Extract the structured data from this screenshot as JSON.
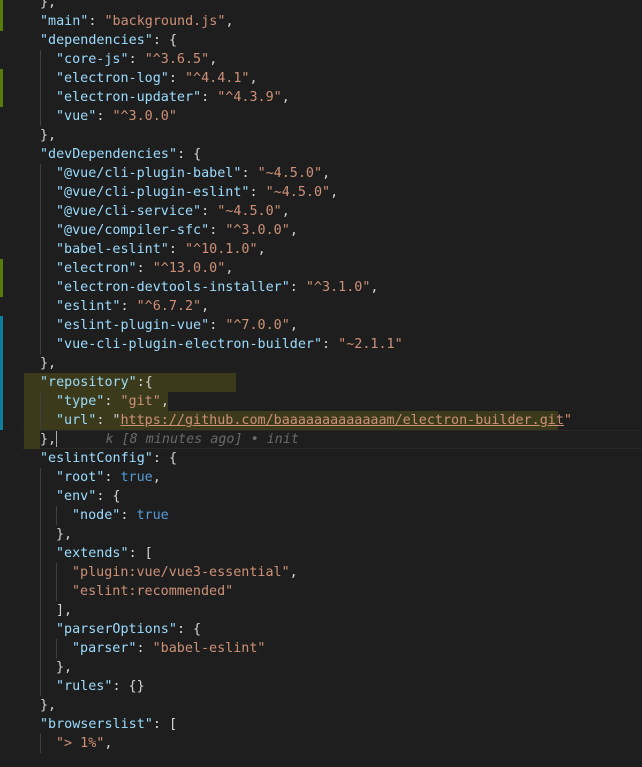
{
  "editor": {
    "language": "json",
    "blame_annotation": "k [8 minutes ago] • init",
    "lines": [
      {
        "kind": "partial",
        "gutter": "modified",
        "indent": 0,
        "text": "}",
        "tokens": [
          {
            "c": "t-punc",
            "v": "},"
          }
        ]
      },
      {
        "gutter": "modified",
        "indent": 0,
        "tokens": [
          {
            "c": "t-key",
            "v": "\"main\""
          },
          {
            "c": "t-punc",
            "v": ": "
          },
          {
            "c": "t-str",
            "v": "\"background.js\""
          },
          {
            "c": "t-punc",
            "v": ","
          }
        ]
      },
      {
        "gutter": "none",
        "indent": 0,
        "tokens": [
          {
            "c": "t-key",
            "v": "\"dependencies\""
          },
          {
            "c": "t-punc",
            "v": ": {"
          }
        ]
      },
      {
        "gutter": "none",
        "indent": 1,
        "tokens": [
          {
            "c": "t-key",
            "v": "\"core-js\""
          },
          {
            "c": "t-punc",
            "v": ": "
          },
          {
            "c": "t-str",
            "v": "\"^3.6.5\""
          },
          {
            "c": "t-punc",
            "v": ","
          }
        ]
      },
      {
        "gutter": "modified",
        "indent": 1,
        "tokens": [
          {
            "c": "t-key",
            "v": "\"electron-log\""
          },
          {
            "c": "t-punc",
            "v": ": "
          },
          {
            "c": "t-str",
            "v": "\"^4.4.1\""
          },
          {
            "c": "t-punc",
            "v": ","
          }
        ]
      },
      {
        "gutter": "modified",
        "indent": 1,
        "tokens": [
          {
            "c": "t-key",
            "v": "\"electron-updater\""
          },
          {
            "c": "t-punc",
            "v": ": "
          },
          {
            "c": "t-str",
            "v": "\"^4.3.9\""
          },
          {
            "c": "t-punc",
            "v": ","
          }
        ]
      },
      {
        "gutter": "none",
        "indent": 1,
        "tokens": [
          {
            "c": "t-key",
            "v": "\"vue\""
          },
          {
            "c": "t-punc",
            "v": ": "
          },
          {
            "c": "t-str",
            "v": "\"^3.0.0\""
          }
        ]
      },
      {
        "gutter": "none",
        "indent": 0,
        "tokens": [
          {
            "c": "t-punc",
            "v": "},"
          }
        ]
      },
      {
        "gutter": "none",
        "indent": 0,
        "tokens": [
          {
            "c": "t-key",
            "v": "\"devDependencies\""
          },
          {
            "c": "t-punc",
            "v": ": {"
          }
        ]
      },
      {
        "gutter": "none",
        "indent": 1,
        "tokens": [
          {
            "c": "t-key",
            "v": "\"@vue/cli-plugin-babel\""
          },
          {
            "c": "t-punc",
            "v": ": "
          },
          {
            "c": "t-str",
            "v": "\"~4.5.0\""
          },
          {
            "c": "t-punc",
            "v": ","
          }
        ]
      },
      {
        "gutter": "none",
        "indent": 1,
        "tokens": [
          {
            "c": "t-key",
            "v": "\"@vue/cli-plugin-eslint\""
          },
          {
            "c": "t-punc",
            "v": ": "
          },
          {
            "c": "t-str",
            "v": "\"~4.5.0\""
          },
          {
            "c": "t-punc",
            "v": ","
          }
        ]
      },
      {
        "gutter": "none",
        "indent": 1,
        "tokens": [
          {
            "c": "t-key",
            "v": "\"@vue/cli-service\""
          },
          {
            "c": "t-punc",
            "v": ": "
          },
          {
            "c": "t-str",
            "v": "\"~4.5.0\""
          },
          {
            "c": "t-punc",
            "v": ","
          }
        ]
      },
      {
        "gutter": "none",
        "indent": 1,
        "tokens": [
          {
            "c": "t-key",
            "v": "\"@vue/compiler-sfc\""
          },
          {
            "c": "t-punc",
            "v": ": "
          },
          {
            "c": "t-str",
            "v": "\"^3.0.0\""
          },
          {
            "c": "t-punc",
            "v": ","
          }
        ]
      },
      {
        "gutter": "none",
        "indent": 1,
        "tokens": [
          {
            "c": "t-key",
            "v": "\"babel-eslint\""
          },
          {
            "c": "t-punc",
            "v": ": "
          },
          {
            "c": "t-str",
            "v": "\"^10.1.0\""
          },
          {
            "c": "t-punc",
            "v": ","
          }
        ]
      },
      {
        "gutter": "modified",
        "indent": 1,
        "tokens": [
          {
            "c": "t-key",
            "v": "\"electron\""
          },
          {
            "c": "t-punc",
            "v": ": "
          },
          {
            "c": "t-str",
            "v": "\"^13.0.0\""
          },
          {
            "c": "t-punc",
            "v": ","
          }
        ]
      },
      {
        "gutter": "modified",
        "indent": 1,
        "tokens": [
          {
            "c": "t-key",
            "v": "\"electron-devtools-installer\""
          },
          {
            "c": "t-punc",
            "v": ": "
          },
          {
            "c": "t-str",
            "v": "\"^3.1.0\""
          },
          {
            "c": "t-punc",
            "v": ","
          }
        ]
      },
      {
        "gutter": "none",
        "indent": 1,
        "tokens": [
          {
            "c": "t-key",
            "v": "\"eslint\""
          },
          {
            "c": "t-punc",
            "v": ": "
          },
          {
            "c": "t-str",
            "v": "\"^6.7.2\""
          },
          {
            "c": "t-punc",
            "v": ","
          }
        ]
      },
      {
        "gutter": "added",
        "indent": 1,
        "tokens": [
          {
            "c": "t-key",
            "v": "\"eslint-plugin-vue\""
          },
          {
            "c": "t-punc",
            "v": ": "
          },
          {
            "c": "t-str",
            "v": "\"^7.0.0\""
          },
          {
            "c": "t-punc",
            "v": ","
          }
        ]
      },
      {
        "gutter": "added",
        "indent": 1,
        "tokens": [
          {
            "c": "t-key",
            "v": "\"vue-cli-plugin-electron-builder\""
          },
          {
            "c": "t-punc",
            "v": ": "
          },
          {
            "c": "t-str",
            "v": "\"~2.1.1\""
          }
        ]
      },
      {
        "gutter": "added",
        "indent": 0,
        "tokens": [
          {
            "c": "t-punc",
            "v": "},"
          }
        ]
      },
      {
        "gutter": "added",
        "indent": 0,
        "highlight": [
          24,
          236
        ],
        "tokens": [
          {
            "c": "t-key",
            "v": "\"repository\""
          },
          {
            "c": "t-punc",
            "v": ":{"
          }
        ]
      },
      {
        "gutter": "added",
        "indent": 1,
        "highlight": [
          24,
          168
        ],
        "tokens": [
          {
            "c": "t-key",
            "v": "\"type\""
          },
          {
            "c": "t-punc",
            "v": ": "
          },
          {
            "c": "t-str",
            "v": "\"git\""
          },
          {
            "c": "t-punc",
            "v": ","
          }
        ]
      },
      {
        "gutter": "added",
        "indent": 1,
        "highlight": [
          24,
          558
        ],
        "tokens": [
          {
            "c": "t-key",
            "v": "\"url\""
          },
          {
            "c": "t-punc",
            "v": ": \""
          },
          {
            "c": "t-link",
            "v": "https://github.com/baaaaaaaaaaaaam/electron-builder.git"
          },
          {
            "c": "t-str",
            "v": "\""
          }
        ]
      },
      {
        "gutter": "none",
        "indent": 0,
        "current": true,
        "highlight": [
          24,
          40
        ],
        "blame": true,
        "tokens": [
          {
            "c": "t-punc",
            "v": "},"
          }
        ]
      },
      {
        "gutter": "none",
        "indent": 0,
        "tokens": [
          {
            "c": "t-key",
            "v": "\"eslintConfig\""
          },
          {
            "c": "t-punc",
            "v": ": {"
          }
        ]
      },
      {
        "gutter": "none",
        "indent": 1,
        "tokens": [
          {
            "c": "t-key",
            "v": "\"root\""
          },
          {
            "c": "t-punc",
            "v": ": "
          },
          {
            "c": "t-bool",
            "v": "true"
          },
          {
            "c": "t-punc",
            "v": ","
          }
        ]
      },
      {
        "gutter": "none",
        "indent": 1,
        "tokens": [
          {
            "c": "t-key",
            "v": "\"env\""
          },
          {
            "c": "t-punc",
            "v": ": {"
          }
        ]
      },
      {
        "gutter": "none",
        "indent": 2,
        "tokens": [
          {
            "c": "t-key",
            "v": "\"node\""
          },
          {
            "c": "t-punc",
            "v": ": "
          },
          {
            "c": "t-bool",
            "v": "true"
          }
        ]
      },
      {
        "gutter": "none",
        "indent": 1,
        "tokens": [
          {
            "c": "t-punc",
            "v": "},"
          }
        ]
      },
      {
        "gutter": "none",
        "indent": 1,
        "tokens": [
          {
            "c": "t-key",
            "v": "\"extends\""
          },
          {
            "c": "t-punc",
            "v": ": ["
          }
        ]
      },
      {
        "gutter": "none",
        "indent": 2,
        "tokens": [
          {
            "c": "t-str",
            "v": "\"plugin:vue/vue3-essential\""
          },
          {
            "c": "t-punc",
            "v": ","
          }
        ]
      },
      {
        "gutter": "none",
        "indent": 2,
        "tokens": [
          {
            "c": "t-str",
            "v": "\"eslint:recommended\""
          }
        ]
      },
      {
        "gutter": "none",
        "indent": 1,
        "tokens": [
          {
            "c": "t-punc",
            "v": "],"
          }
        ]
      },
      {
        "gutter": "none",
        "indent": 1,
        "tokens": [
          {
            "c": "t-key",
            "v": "\"parserOptions\""
          },
          {
            "c": "t-punc",
            "v": ": {"
          }
        ]
      },
      {
        "gutter": "none",
        "indent": 2,
        "tokens": [
          {
            "c": "t-key",
            "v": "\"parser\""
          },
          {
            "c": "t-punc",
            "v": ": "
          },
          {
            "c": "t-str",
            "v": "\"babel-eslint\""
          }
        ]
      },
      {
        "gutter": "none",
        "indent": 1,
        "tokens": [
          {
            "c": "t-punc",
            "v": "},"
          }
        ]
      },
      {
        "gutter": "none",
        "indent": 1,
        "tokens": [
          {
            "c": "t-key",
            "v": "\"rules\""
          },
          {
            "c": "t-punc",
            "v": ": {}"
          }
        ]
      },
      {
        "gutter": "none",
        "indent": 0,
        "tokens": [
          {
            "c": "t-punc",
            "v": "},"
          }
        ]
      },
      {
        "gutter": "none",
        "indent": 0,
        "tokens": [
          {
            "c": "t-key",
            "v": "\"browserslist\""
          },
          {
            "c": "t-punc",
            "v": ": ["
          }
        ]
      },
      {
        "gutter": "none",
        "indent": 1,
        "tokens": [
          {
            "c": "t-str",
            "v": "\"> 1%\""
          },
          {
            "c": "t-punc",
            "v": ","
          }
        ]
      }
    ]
  }
}
